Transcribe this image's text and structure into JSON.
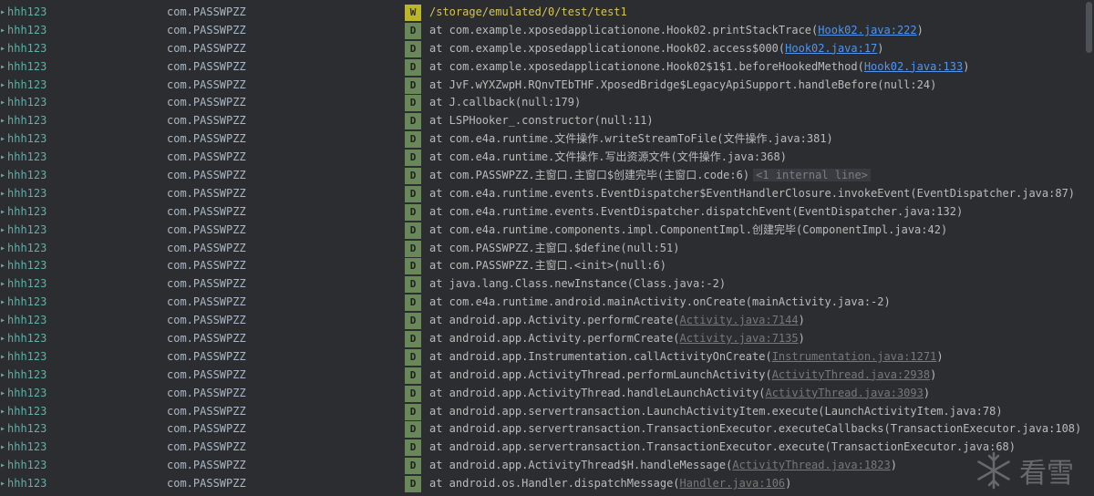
{
  "logcat": {
    "rows": [
      {
        "tag": "hhh123",
        "package": "com.PASSWPZZ",
        "level": "W",
        "msg_prefix": "/storage/emulated/0/test/test1",
        "link": "",
        "msg_suffix": "",
        "note": ""
      },
      {
        "tag": "hhh123",
        "package": "com.PASSWPZZ",
        "level": "D",
        "msg_prefix": "at com.example.xposedapplicationone.Hook02.printStackTrace(",
        "link": "Hook02.java:222",
        "msg_suffix": ")",
        "note": ""
      },
      {
        "tag": "hhh123",
        "package": "com.PASSWPZZ",
        "level": "D",
        "msg_prefix": "at com.example.xposedapplicationone.Hook02.access$000(",
        "link": "Hook02.java:17",
        "msg_suffix": ")",
        "note": ""
      },
      {
        "tag": "hhh123",
        "package": "com.PASSWPZZ",
        "level": "D",
        "msg_prefix": "at com.example.xposedapplicationone.Hook02$1$1.beforeHookedMethod(",
        "link": "Hook02.java:133",
        "msg_suffix": ")",
        "note": ""
      },
      {
        "tag": "hhh123",
        "package": "com.PASSWPZZ",
        "level": "D",
        "msg_prefix": "at JvF.wYXZwpH.RQnvTEbTHF.XposedBridge$LegacyApiSupport.handleBefore(null:24)",
        "link": "",
        "msg_suffix": "",
        "note": ""
      },
      {
        "tag": "hhh123",
        "package": "com.PASSWPZZ",
        "level": "D",
        "msg_prefix": "at J.callback(null:179)",
        "link": "",
        "msg_suffix": "",
        "note": ""
      },
      {
        "tag": "hhh123",
        "package": "com.PASSWPZZ",
        "level": "D",
        "msg_prefix": "at LSPHooker_.constructor(null:11)",
        "link": "",
        "msg_suffix": "",
        "note": ""
      },
      {
        "tag": "hhh123",
        "package": "com.PASSWPZZ",
        "level": "D",
        "msg_prefix": "at com.e4a.runtime.文件操作.writeStreamToFile(文件操作.java:381)",
        "link": "",
        "msg_suffix": "",
        "note": ""
      },
      {
        "tag": "hhh123",
        "package": "com.PASSWPZZ",
        "level": "D",
        "msg_prefix": "at com.e4a.runtime.文件操作.写出资源文件(文件操作.java:368)",
        "link": "",
        "msg_suffix": "",
        "note": ""
      },
      {
        "tag": "hhh123",
        "package": "com.PASSWPZZ",
        "level": "D",
        "msg_prefix": "at com.PASSWPZZ.主窗口.主窗口$创建完毕(主窗口.code:6)",
        "link": "",
        "msg_suffix": "",
        "note": "<1 internal line>"
      },
      {
        "tag": "hhh123",
        "package": "com.PASSWPZZ",
        "level": "D",
        "msg_prefix": "at com.e4a.runtime.events.EventDispatcher$EventHandlerClosure.invokeEvent(EventDispatcher.java:87)",
        "link": "",
        "msg_suffix": "",
        "note": ""
      },
      {
        "tag": "hhh123",
        "package": "com.PASSWPZZ",
        "level": "D",
        "msg_prefix": "at com.e4a.runtime.events.EventDispatcher.dispatchEvent(EventDispatcher.java:132)",
        "link": "",
        "msg_suffix": "",
        "note": ""
      },
      {
        "tag": "hhh123",
        "package": "com.PASSWPZZ",
        "level": "D",
        "msg_prefix": "at com.e4a.runtime.components.impl.ComponentImpl.创建完毕(ComponentImpl.java:42)",
        "link": "",
        "msg_suffix": "",
        "note": ""
      },
      {
        "tag": "hhh123",
        "package": "com.PASSWPZZ",
        "level": "D",
        "msg_prefix": "at com.PASSWPZZ.主窗口.$define(null:51)",
        "link": "",
        "msg_suffix": "",
        "note": ""
      },
      {
        "tag": "hhh123",
        "package": "com.PASSWPZZ",
        "level": "D",
        "msg_prefix": "at com.PASSWPZZ.主窗口.<init>(null:6)",
        "link": "",
        "msg_suffix": "",
        "note": ""
      },
      {
        "tag": "hhh123",
        "package": "com.PASSWPZZ",
        "level": "D",
        "msg_prefix": "at java.lang.Class.newInstance(Class.java:-2)",
        "link": "",
        "msg_suffix": "",
        "note": ""
      },
      {
        "tag": "hhh123",
        "package": "com.PASSWPZZ",
        "level": "D",
        "msg_prefix": "at com.e4a.runtime.android.mainActivity.onCreate(mainActivity.java:-2)",
        "link": "",
        "msg_suffix": "",
        "note": ""
      },
      {
        "tag": "hhh123",
        "package": "com.PASSWPZZ",
        "level": "D",
        "msg_prefix": "at android.app.Activity.performCreate(",
        "link": "Activity.java:7144",
        "msg_suffix": ")",
        "note": ""
      },
      {
        "tag": "hhh123",
        "package": "com.PASSWPZZ",
        "level": "D",
        "msg_prefix": "at android.app.Activity.performCreate(",
        "link": "Activity.java:7135",
        "msg_suffix": ")",
        "note": ""
      },
      {
        "tag": "hhh123",
        "package": "com.PASSWPZZ",
        "level": "D",
        "msg_prefix": "at android.app.Instrumentation.callActivityOnCreate(",
        "link": "Instrumentation.java:1271",
        "msg_suffix": ")",
        "note": ""
      },
      {
        "tag": "hhh123",
        "package": "com.PASSWPZZ",
        "level": "D",
        "msg_prefix": "at android.app.ActivityThread.performLaunchActivity(",
        "link": "ActivityThread.java:2938",
        "msg_suffix": ")",
        "note": ""
      },
      {
        "tag": "hhh123",
        "package": "com.PASSWPZZ",
        "level": "D",
        "msg_prefix": "at android.app.ActivityThread.handleLaunchActivity(",
        "link": "ActivityThread.java:3093",
        "msg_suffix": ")",
        "note": ""
      },
      {
        "tag": "hhh123",
        "package": "com.PASSWPZZ",
        "level": "D",
        "msg_prefix": "at android.app.servertransaction.LaunchActivityItem.execute(LaunchActivityItem.java:78)",
        "link": "",
        "msg_suffix": "",
        "note": ""
      },
      {
        "tag": "hhh123",
        "package": "com.PASSWPZZ",
        "level": "D",
        "msg_prefix": "at android.app.servertransaction.TransactionExecutor.executeCallbacks(TransactionExecutor.java:108)",
        "link": "",
        "msg_suffix": "",
        "note": ""
      },
      {
        "tag": "hhh123",
        "package": "com.PASSWPZZ",
        "level": "D",
        "msg_prefix": "at android.app.servertransaction.TransactionExecutor.execute(TransactionExecutor.java:68)",
        "link": "",
        "msg_suffix": "",
        "note": ""
      },
      {
        "tag": "hhh123",
        "package": "com.PASSWPZZ",
        "level": "D",
        "msg_prefix": "at android.app.ActivityThread$H.handleMessage(",
        "link": "ActivityThread.java:1823",
        "msg_suffix": ")",
        "note": ""
      },
      {
        "tag": "hhh123",
        "package": "com.PASSWPZZ",
        "level": "D",
        "msg_prefix": "at android.os.Handler.dispatchMessage(",
        "link": "Handler.java:106",
        "msg_suffix": ")",
        "note": ""
      }
    ],
    "link_blue_rows": [
      1,
      2,
      3
    ],
    "colors": {
      "background": "#2b2d30",
      "tag": "#5fb0a8",
      "debug_badge": "#6a8759",
      "warn_badge": "#bbb529",
      "link_blue": "#5394ec",
      "link_gray": "#787878"
    }
  },
  "watermark": {
    "text": "看雪",
    "icon": "snowflake-logo"
  }
}
